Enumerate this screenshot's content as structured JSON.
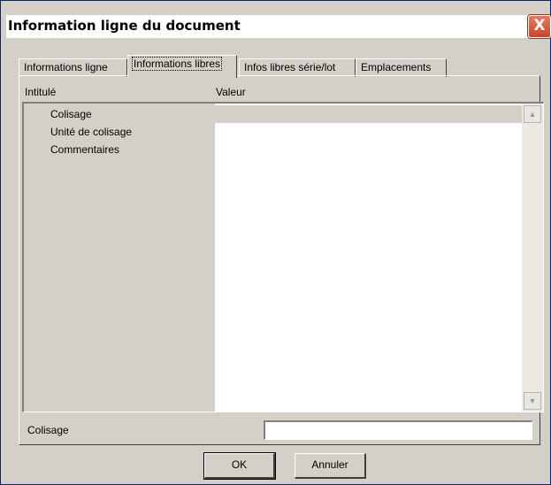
{
  "window": {
    "title": "Information ligne du document",
    "close_glyph": "X"
  },
  "tabs": [
    {
      "label": "Informations ligne",
      "active": false
    },
    {
      "label": "Informations libres",
      "active": true
    },
    {
      "label": "Infos libres série/lot",
      "active": false
    },
    {
      "label": "Emplacements",
      "active": false
    }
  ],
  "list": {
    "headers": {
      "label": "Intitulé",
      "value": "Valeur"
    },
    "rows": [
      {
        "label": "Colisage",
        "value": "",
        "selected": true
      },
      {
        "label": "Unité de colisage",
        "value": "",
        "selected": false
      },
      {
        "label": "Commentaires",
        "value": "",
        "selected": false
      }
    ],
    "scroll_up_icon": "▲",
    "scroll_down_icon": "▼"
  },
  "field": {
    "label": "Colisage",
    "value": ""
  },
  "buttons": {
    "ok": "OK",
    "cancel": "Annuler"
  }
}
